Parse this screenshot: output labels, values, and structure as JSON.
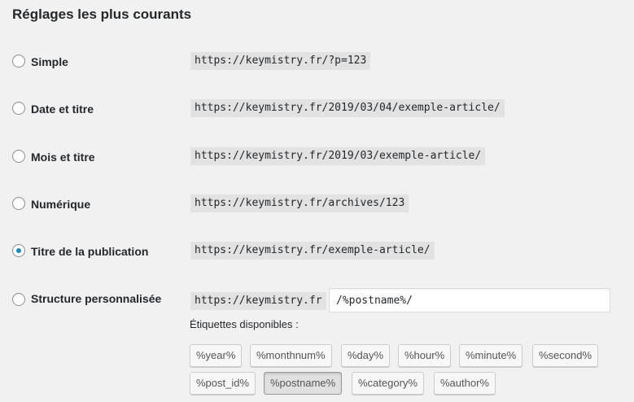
{
  "section_title": "Réglages les plus courants",
  "options": [
    {
      "label": "Simple",
      "example": "https://keymistry.fr/?p=123",
      "checked": false
    },
    {
      "label": "Date et titre",
      "example": "https://keymistry.fr/2019/03/04/exemple-article/",
      "checked": false
    },
    {
      "label": "Mois et titre",
      "example": "https://keymistry.fr/2019/03/exemple-article/",
      "checked": false
    },
    {
      "label": "Numérique",
      "example": "https://keymistry.fr/archives/123",
      "checked": false
    },
    {
      "label": "Titre de la publication",
      "example": "https://keymistry.fr/exemple-article/",
      "checked": true
    },
    {
      "label": "Structure personnalisée",
      "example": "https://keymistry.fr",
      "checked": false
    }
  ],
  "custom_structure_value": "/%postname%/",
  "tags_label": "Étiquettes disponibles :",
  "tags": [
    "%year%",
    "%monthnum%",
    "%day%",
    "%hour%",
    "%minute%",
    "%second%",
    "%post_id%",
    "%postname%",
    "%category%",
    "%author%"
  ],
  "active_tag": "%postname%",
  "colors": {
    "accent": "#1e8cbe",
    "background": "#f1f1f1",
    "code_background": "#e2e2e2"
  }
}
